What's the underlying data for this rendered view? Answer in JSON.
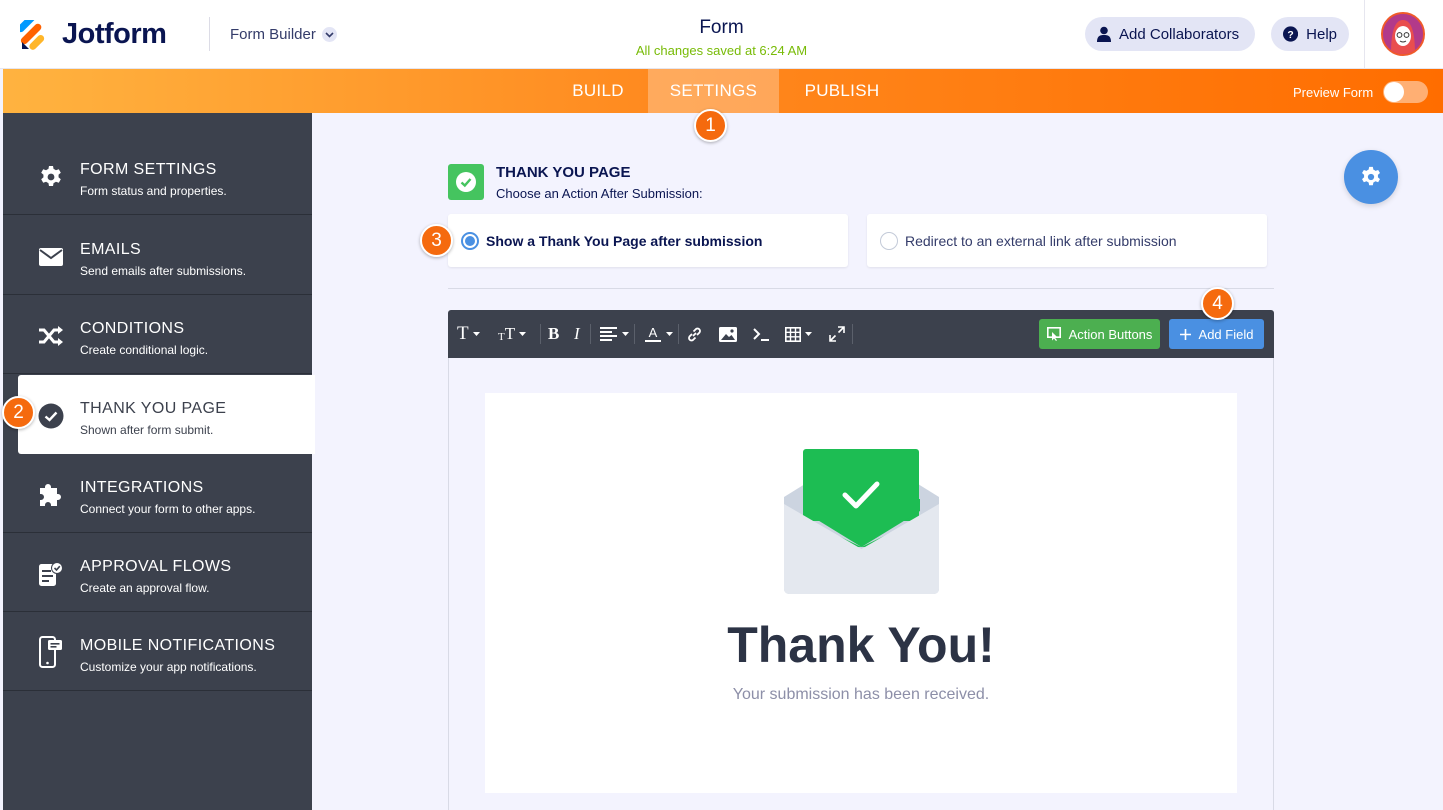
{
  "header": {
    "logo_text": "Jotform",
    "builder_label": "Form Builder",
    "form_title": "Form",
    "save_status": "All changes saved at 6:24 AM",
    "collaborators_label": "Add Collaborators",
    "help_label": "Help"
  },
  "nav": {
    "tabs": [
      {
        "label": "BUILD"
      },
      {
        "label": "SETTINGS",
        "active": true
      },
      {
        "label": "PUBLISH"
      }
    ],
    "preview_label": "Preview Form",
    "preview_on": false
  },
  "sidebar": {
    "items": [
      {
        "title": "FORM SETTINGS",
        "subtitle": "Form status and properties.",
        "icon": "gear-icon"
      },
      {
        "title": "EMAILS",
        "subtitle": "Send emails after submissions.",
        "icon": "envelope-icon"
      },
      {
        "title": "CONDITIONS",
        "subtitle": "Create conditional logic.",
        "icon": "shuffle-icon"
      },
      {
        "title": "THANK YOU PAGE",
        "subtitle": "Shown after form submit.",
        "icon": "check-circle-icon",
        "active": true
      },
      {
        "title": "INTEGRATIONS",
        "subtitle": "Connect your form to other apps.",
        "icon": "puzzle-icon"
      },
      {
        "title": "APPROVAL FLOWS",
        "subtitle": "Create an approval flow.",
        "icon": "approval-doc-icon"
      },
      {
        "title": "MOBILE NOTIFICATIONS",
        "subtitle": "Customize your app notifications.",
        "icon": "mobile-icon"
      }
    ]
  },
  "main": {
    "section_title": "THANK YOU PAGE",
    "section_subtitle": "Choose an Action After Submission:",
    "options": [
      {
        "label": "Show a Thank You Page after submission",
        "selected": true
      },
      {
        "label": "Redirect to an external link after submission",
        "selected": false
      }
    ],
    "editor": {
      "toolbar_icons": [
        "font-icon",
        "font-size-icon",
        "bold-icon",
        "italic-icon",
        "align-icon",
        "text-color-icon",
        "link-icon",
        "image-icon",
        "code-icon",
        "table-icon",
        "expand-icon"
      ],
      "action_buttons_label": "Action Buttons",
      "add_field_label": "Add Field"
    },
    "thank_you": {
      "heading": "Thank You!",
      "message": "Your submission has been received."
    }
  },
  "badges": [
    "1",
    "2",
    "3",
    "4"
  ],
  "colors": {
    "brand_orange": "#ff6d00",
    "sidebar_bg": "#3c414d",
    "accent_blue": "#4a90e2",
    "success_green": "#45c45f"
  }
}
